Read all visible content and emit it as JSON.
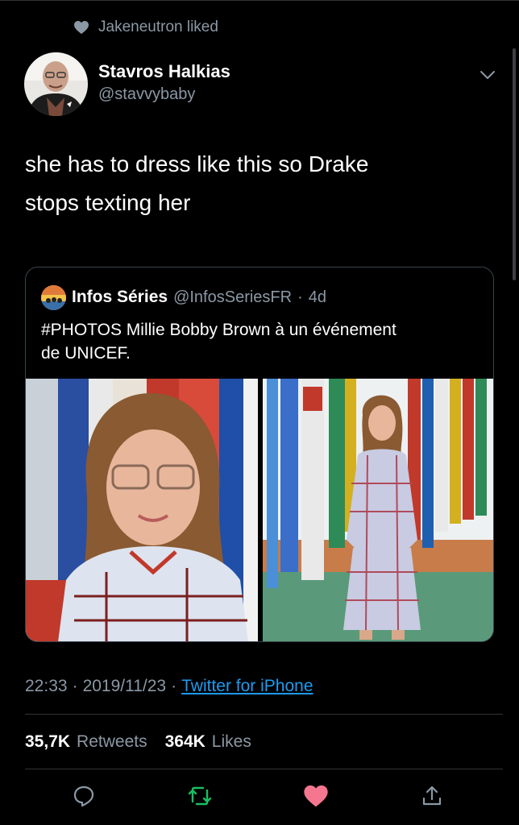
{
  "social_context": {
    "text": "Jakeneutron liked",
    "icon": "heart-icon"
  },
  "author": {
    "name": "Stavros Halkias",
    "handle": "@stavvybaby"
  },
  "tweet": {
    "lines": [
      "she has to dress like this so Drake",
      "stops texting her"
    ]
  },
  "quote": {
    "name": "Infos Séries",
    "handle": "@InfosSeriesFR",
    "separator": "·",
    "time": "4d",
    "lines": [
      "#PHOTOS Millie Bobby Brown à un événement",
      "de UNICEF."
    ]
  },
  "meta": {
    "time": "22:33",
    "dot1": "·",
    "date": "2019/11/23",
    "dot2": "·",
    "source": "Twitter for iPhone"
  },
  "stats": {
    "retweets_count": "35,7K",
    "retweets_label": "Retweets",
    "likes_count": "364K",
    "likes_label": "Likes"
  },
  "actions": {
    "reply_icon": "reply-icon",
    "retweet_icon": "retweet-icon",
    "like_icon": "heart-filled-icon",
    "share_icon": "share-icon"
  },
  "colors": {
    "background": "#000000",
    "secondary_text": "#8b98a5",
    "link": "#1d9bf0",
    "retweet_green": "#17bf63",
    "like_pink": "#f91880",
    "border": "#38444d"
  }
}
